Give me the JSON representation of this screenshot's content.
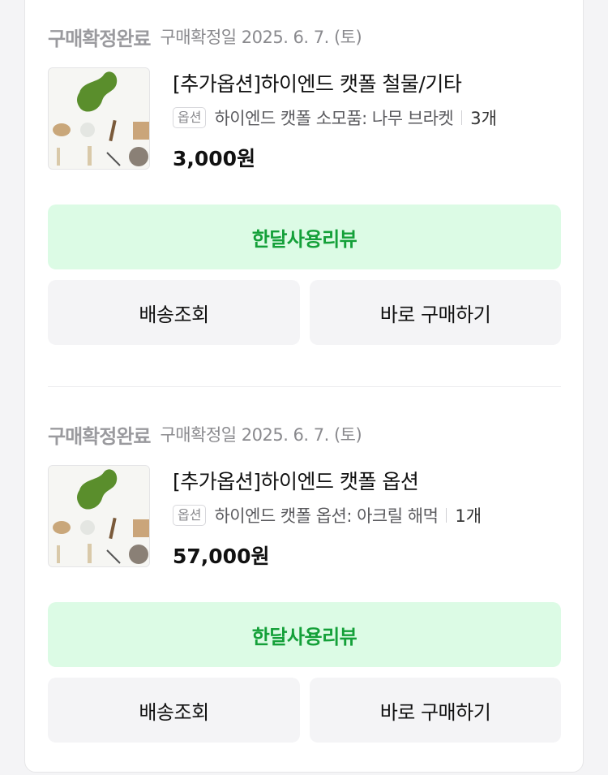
{
  "orders": [
    {
      "status": "구매확정완료",
      "date_text": "구매확정일 2025. 6. 7. (토)",
      "product_title": "[추가옵션]하이엔드 캣폴 철물/기타",
      "option_tag": "옵션",
      "option_text": "하이엔드 캣폴 소모품: 나무 브라켓",
      "quantity": "3개",
      "price": "3,000원",
      "review_button": "한달사용리뷰",
      "track_button": "배송조회",
      "buy_button": "바로 구매하기"
    },
    {
      "status": "구매확정완료",
      "date_text": "구매확정일 2025. 6. 7. (토)",
      "product_title": "[추가옵션]하이엔드 캣폴 옵션",
      "option_tag": "옵션",
      "option_text": "하이엔드 캣폴 옵션: 아크릴 해먹",
      "quantity": "1개",
      "price": "57,000원",
      "review_button": "한달사용리뷰",
      "track_button": "배송조회",
      "buy_button": "바로 구매하기"
    }
  ],
  "colors": {
    "review_bg": "#dcfbe5",
    "review_text": "#14a039",
    "status_gray": "#9a9a9e"
  }
}
